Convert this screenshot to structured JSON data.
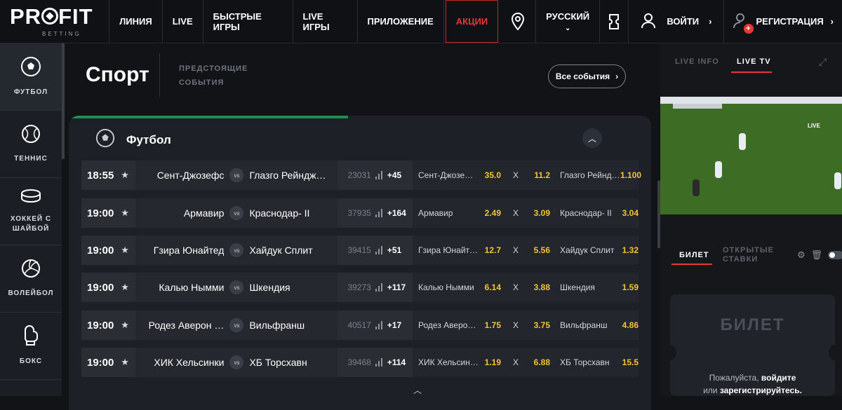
{
  "logo": {
    "text_a": "PR",
    "text_b": "FIT",
    "sub": "BETTING"
  },
  "nav": {
    "items": [
      "ЛИНИЯ",
      "LIVE",
      "БЫСТРЫЕ ИГРЫ",
      "LIVE ИГРЫ",
      "ПРИЛОЖЕНИЕ",
      "АКЦИИ"
    ],
    "language": "РУССКИЙ",
    "login": "ВОЙТИ",
    "register": "РЕГИСТРАЦИЯ"
  },
  "sidebar": {
    "items": [
      {
        "label": "ФУТБОЛ",
        "icon": "football-icon"
      },
      {
        "label": "ТЕННИС",
        "icon": "tennis-icon"
      },
      {
        "label": "ХОККЕЙ С ШАЙБОЙ",
        "icon": "hockey-puck-icon"
      },
      {
        "label": "ВОЛЕЙБОЛ",
        "icon": "volleyball-icon"
      },
      {
        "label": "БОКС",
        "icon": "boxing-glove-icon"
      }
    ]
  },
  "main": {
    "title": "Спорт",
    "upcoming_line1": "ПРЕДСТОЯЩИЕ",
    "upcoming_line2": "СОБЫТИЯ",
    "all_events": "Все события",
    "sport_heading": "Футбол",
    "vs_label": "vs",
    "draw_label": "X",
    "matches": [
      {
        "time": "18:55",
        "team1": "Сент-Джозефс",
        "team2": "Глазго Рейндж…",
        "count": "23031",
        "markets": "+45",
        "odd1_name": "Сент-Джозе…",
        "odd1": "35.0",
        "draw": "11.2",
        "odd2_name": "Глазго Рейнд…",
        "odd2": "1.100"
      },
      {
        "time": "19:00",
        "team1": "Армавир",
        "team2": "Краснодар- II",
        "count": "37935",
        "markets": "+164",
        "odd1_name": "Армавир",
        "odd1": "2.49",
        "draw": "3.09",
        "odd2_name": "Краснодар- II",
        "odd2": "3.04"
      },
      {
        "time": "19:00",
        "team1": "Гзира Юнайтед",
        "team2": "Хайдук Сплит",
        "count": "39415",
        "markets": "+51",
        "odd1_name": "Гзира Юнайт…",
        "odd1": "12.7",
        "draw": "5.56",
        "odd2_name": "Хайдук Сплит",
        "odd2": "1.32"
      },
      {
        "time": "19:00",
        "team1": "Калью Нымми",
        "team2": "Шкендия",
        "count": "39273",
        "markets": "+117",
        "odd1_name": "Калью Нымми",
        "odd1": "6.14",
        "draw": "3.88",
        "odd2_name": "Шкендия",
        "odd2": "1.59"
      },
      {
        "time": "19:00",
        "team1": "Родез Аверон …",
        "team2": "Вильфранш",
        "count": "40517",
        "markets": "+17",
        "odd1_name": "Родез Аверо…",
        "odd1": "1.75",
        "draw": "3.75",
        "odd2_name": "Вильфранш",
        "odd2": "4.86"
      },
      {
        "time": "19:00",
        "team1": "ХИК Хельсинки",
        "team2": "ХБ Торсхавн",
        "count": "39468",
        "markets": "+114",
        "odd1_name": "ХИК Хельсин…",
        "odd1": "1.19",
        "draw": "6.88",
        "odd2_name": "ХБ Торсхавн",
        "odd2": "15.5"
      }
    ]
  },
  "right": {
    "tab_info": "LIVE INFO",
    "tab_tv": "LIVE TV",
    "video_live": "LIVE",
    "tab_ticket": "БИЛЕТ",
    "tab_open_1": "ОТКРЫТЫЕ",
    "tab_open_2": "СТАВКИ",
    "ticket_title": "БИЛЕТ",
    "msg_a": "Пожалуйста, ",
    "msg_login": "войдите",
    "msg_b": "или ",
    "msg_register": "зарегистрируйтесь."
  },
  "colors": {
    "accent_red": "#e53935",
    "odds_yellow": "#f2c335",
    "section_green": "#1e8e4f"
  }
}
